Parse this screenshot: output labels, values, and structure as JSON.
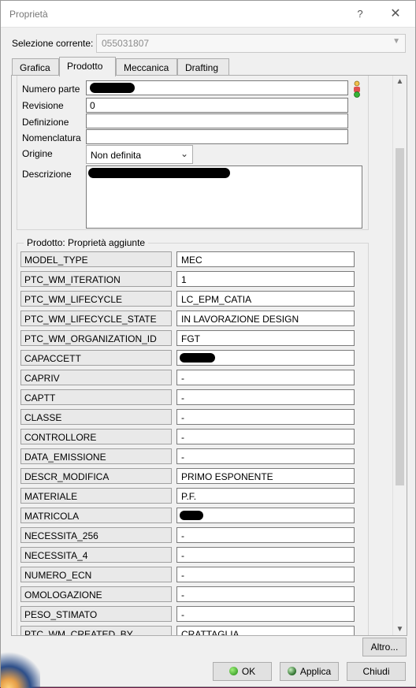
{
  "window": {
    "title": "Proprietà",
    "help_glyph": "?",
    "close_glyph": "✕"
  },
  "selection": {
    "label": "Selezione corrente:",
    "value": "055031807"
  },
  "tabs": [
    {
      "label": "Grafica"
    },
    {
      "label": "Prodotto"
    },
    {
      "label": "Meccanica"
    },
    {
      "label": "Drafting"
    }
  ],
  "product": {
    "part_number_label": "Numero parte",
    "revision_label": "Revisione",
    "revision_value": "0",
    "definition_label": "Definizione",
    "definition_value": "",
    "nomenclature_label": "Nomenclatura",
    "nomenclature_value": "",
    "origin_label": "Origine",
    "origin_value": "Non definita",
    "description_label": "Descrizione"
  },
  "added_properties": {
    "title": "Prodotto: Proprietà aggiunte",
    "rows": [
      {
        "name": "MODEL_TYPE",
        "value": "MEC"
      },
      {
        "name": "PTC_WM_ITERATION",
        "value": "1"
      },
      {
        "name": "PTC_WM_LIFECYCLE",
        "value": "LC_EPM_CATIA"
      },
      {
        "name": "PTC_WM_LIFECYCLE_STATE",
        "value": "IN LAVORAZIONE DESIGN"
      },
      {
        "name": "PTC_WM_ORGANIZATION_ID",
        "value": "FGT"
      },
      {
        "name": "CAPACCETT",
        "value": ""
      },
      {
        "name": "CAPRIV",
        "value": "-"
      },
      {
        "name": "CAPTT",
        "value": "-"
      },
      {
        "name": "CLASSE",
        "value": "-"
      },
      {
        "name": "CONTROLLORE",
        "value": "-"
      },
      {
        "name": "DATA_EMISSIONE",
        "value": "-"
      },
      {
        "name": "DESCR_MODIFICA",
        "value": "PRIMO ESPONENTE"
      },
      {
        "name": "MATERIALE",
        "value": "P.F."
      },
      {
        "name": "MATRICOLA",
        "value": ""
      },
      {
        "name": "NECESSITA_256",
        "value": "-"
      },
      {
        "name": "NECESSITA_4",
        "value": "-"
      },
      {
        "name": "NUMERO_ECN",
        "value": "-"
      },
      {
        "name": "OMOLOGAZIONE",
        "value": "-"
      },
      {
        "name": "PESO_STIMATO",
        "value": "-"
      },
      {
        "name": "PTC_WM_CREATED_BY",
        "value": "CRATTAGLIA"
      }
    ]
  },
  "buttons": {
    "more": "Altro...",
    "ok": "OK",
    "apply": "Applica",
    "close": "Chiudi"
  }
}
